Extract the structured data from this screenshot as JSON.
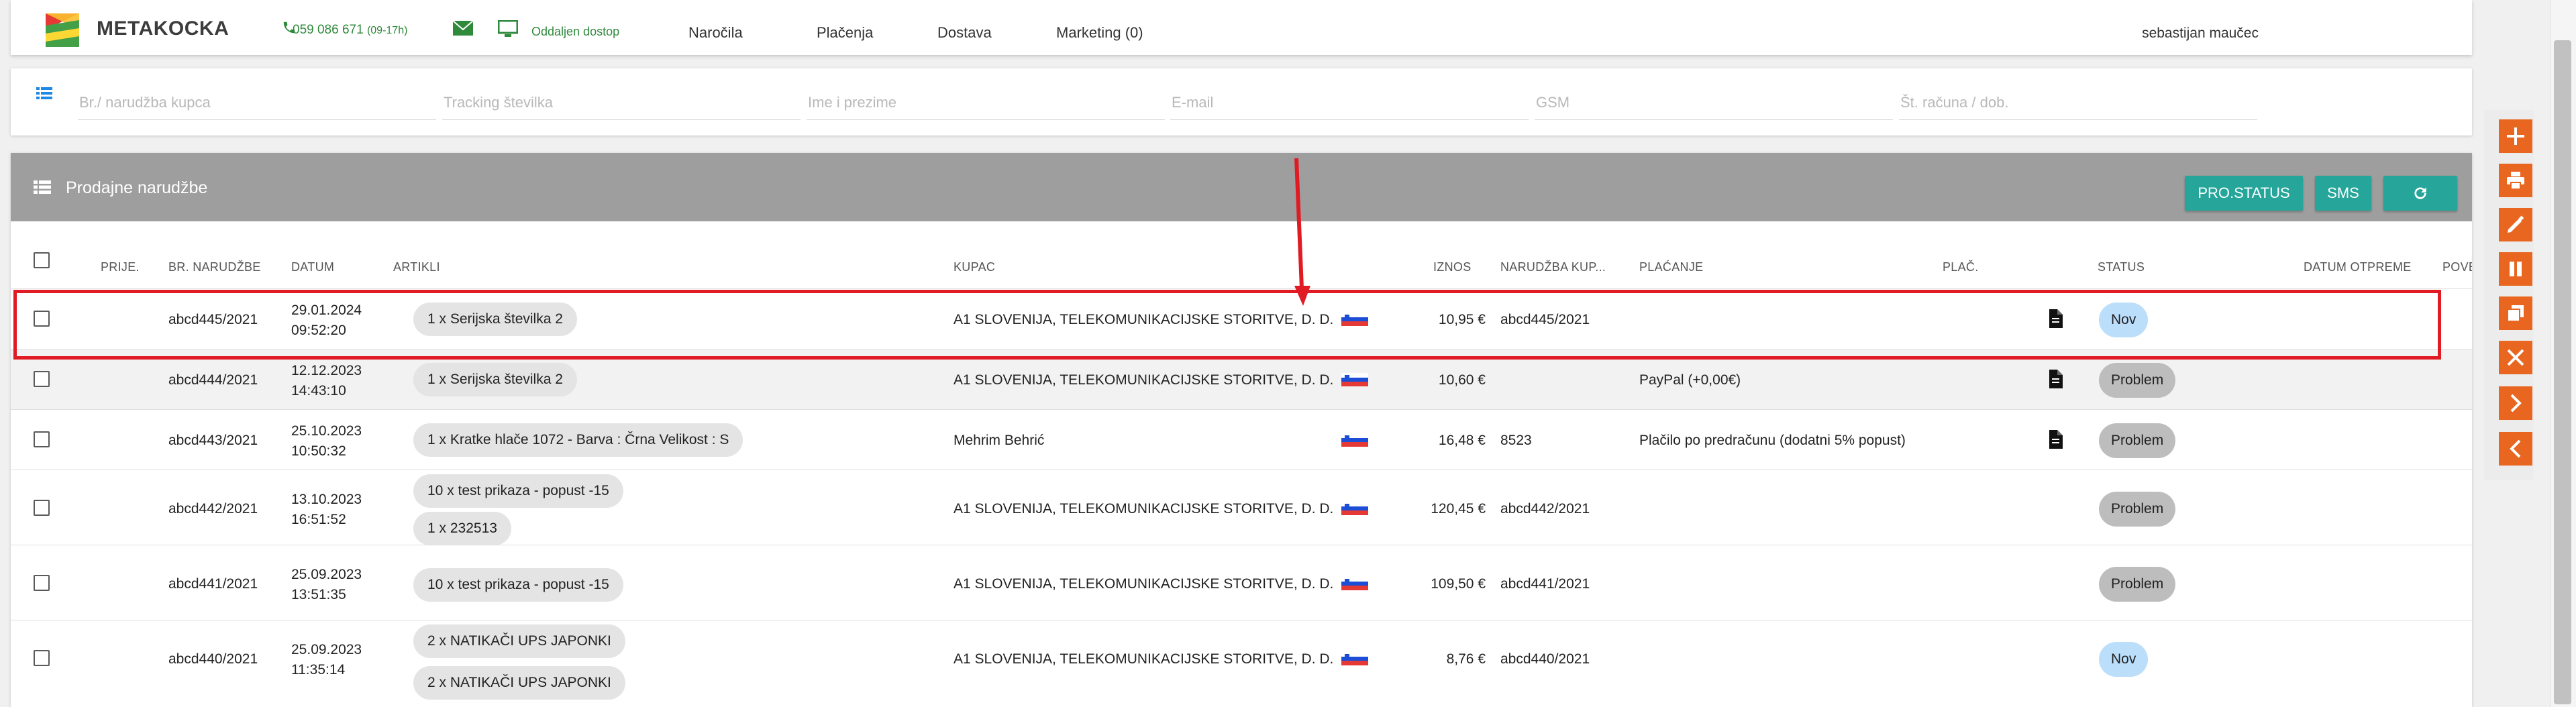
{
  "app": {
    "name": "METAKOCKA"
  },
  "topbar": {
    "phone": "059 086 671",
    "phone_hours": "(09-17h)",
    "remote_label": "Oddaljen dostop",
    "nav": [
      "Naročila",
      "Plačenja",
      "Dostava",
      "Marketing (0)"
    ],
    "user": "sebastijan maučec"
  },
  "search": {
    "placeholders": [
      "Br./ narudžba kupca",
      "Tracking številka",
      "Ime i prezime",
      "E-mail",
      "GSM",
      "Št. računa / dob."
    ]
  },
  "panel": {
    "title": "Prodajne narudžbe",
    "buttons": {
      "status": "PRO.STATUS",
      "sms": "SMS"
    }
  },
  "table": {
    "headers": [
      "PRIJE.",
      "BR. NARUDŽBE",
      "DATUM",
      "ARTIKLI",
      "KUPAC",
      "IZNOS",
      "NARUDŽBA KUP...",
      "PLAĆANJE",
      "PLAČ.",
      "STATUS",
      "DATUM OTPREME",
      "POVE"
    ],
    "rows": [
      {
        "id": "abcd445/2021",
        "date": "29.01.2024",
        "time": "09:52:20",
        "items": [
          "1 x Serijska številka 2"
        ],
        "customer": "A1 SLOVENIJA, TELEKOMUNIKACIJSKE STORITVE, D. D.",
        "amount": "10,95 €",
        "cust_order": "abcd445/2021",
        "payment": "",
        "doc": true,
        "status": "Nov"
      },
      {
        "id": "abcd444/2021",
        "date": "12.12.2023",
        "time": "14:43:10",
        "items": [
          "1 x Serijska številka 2"
        ],
        "customer": "A1 SLOVENIJA, TELEKOMUNIKACIJSKE STORITVE, D. D.",
        "amount": "10,60 €",
        "cust_order": "",
        "payment": "PayPal (+0,00€)",
        "doc": true,
        "status": "Problem"
      },
      {
        "id": "abcd443/2021",
        "date": "25.10.2023",
        "time": "10:50:32",
        "items": [
          "1 x Kratke hlače 1072 - Barva : Črna Velikost : S"
        ],
        "customer": "Mehrim Behrić",
        "amount": "16,48 €",
        "cust_order": "8523",
        "payment": "Plačilo po predračunu (dodatni 5% popust)",
        "doc": true,
        "status": "Problem"
      },
      {
        "id": "abcd442/2021",
        "date": "13.10.2023",
        "time": "16:51:52",
        "items": [
          "10 x test prikaza - popust -15",
          "1 x 232513"
        ],
        "customer": "A1 SLOVENIJA, TELEKOMUNIKACIJSKE STORITVE, D. D.",
        "amount": "120,45 €",
        "cust_order": "abcd442/2021",
        "payment": "",
        "doc": false,
        "status": "Problem"
      },
      {
        "id": "abcd441/2021",
        "date": "25.09.2023",
        "time": "13:51:35",
        "items": [
          "10 x test prikaza - popust -15"
        ],
        "customer": "A1 SLOVENIJA, TELEKOMUNIKACIJSKE STORITVE, D. D.",
        "amount": "109,50 €",
        "cust_order": "abcd441/2021",
        "payment": "",
        "doc": false,
        "status": "Problem"
      },
      {
        "id": "abcd440/2021",
        "date": "25.09.2023",
        "time": "11:35:14",
        "items": [
          "2 x NATIKAČI UPS JAPONKI",
          "2 x NATIKAČI UPS JAPONKI"
        ],
        "customer": "A1 SLOVENIJA, TELEKOMUNIKACIJSKE STORITVE, D. D.",
        "amount": "8,76 €",
        "cust_order": "abcd440/2021",
        "payment": "",
        "doc": false,
        "status": "Nov"
      }
    ]
  },
  "colors": {
    "accent": "#26a69a",
    "action": "#e8661f",
    "link": "#1e88e5",
    "header_gray": "#9e9e9e",
    "status_new": "#bbdefb",
    "status_problem": "#bdbdbd",
    "annotation": "#e01b24"
  },
  "icons": [
    "list-icon",
    "phone-icon",
    "mail-icon",
    "monitor-icon",
    "refresh-icon",
    "document-icon",
    "flag-si-icon",
    "plus-icon",
    "print-icon",
    "edit-icon",
    "pause-icon",
    "copy-icon",
    "close-icon",
    "chevron-right-icon",
    "chevron-left-icon"
  ]
}
